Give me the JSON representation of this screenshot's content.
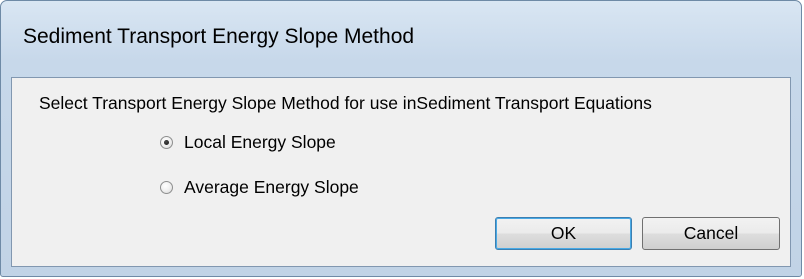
{
  "window": {
    "title": "Sediment Transport Energy Slope Method"
  },
  "dialog": {
    "prompt": "Select Transport Energy Slope Method for use inSediment Transport Equations",
    "options": [
      {
        "label": "Local Energy Slope",
        "selected": true
      },
      {
        "label": "Average Energy Slope",
        "selected": false
      }
    ],
    "buttons": {
      "ok_label": "OK",
      "cancel_label": "Cancel"
    }
  }
}
